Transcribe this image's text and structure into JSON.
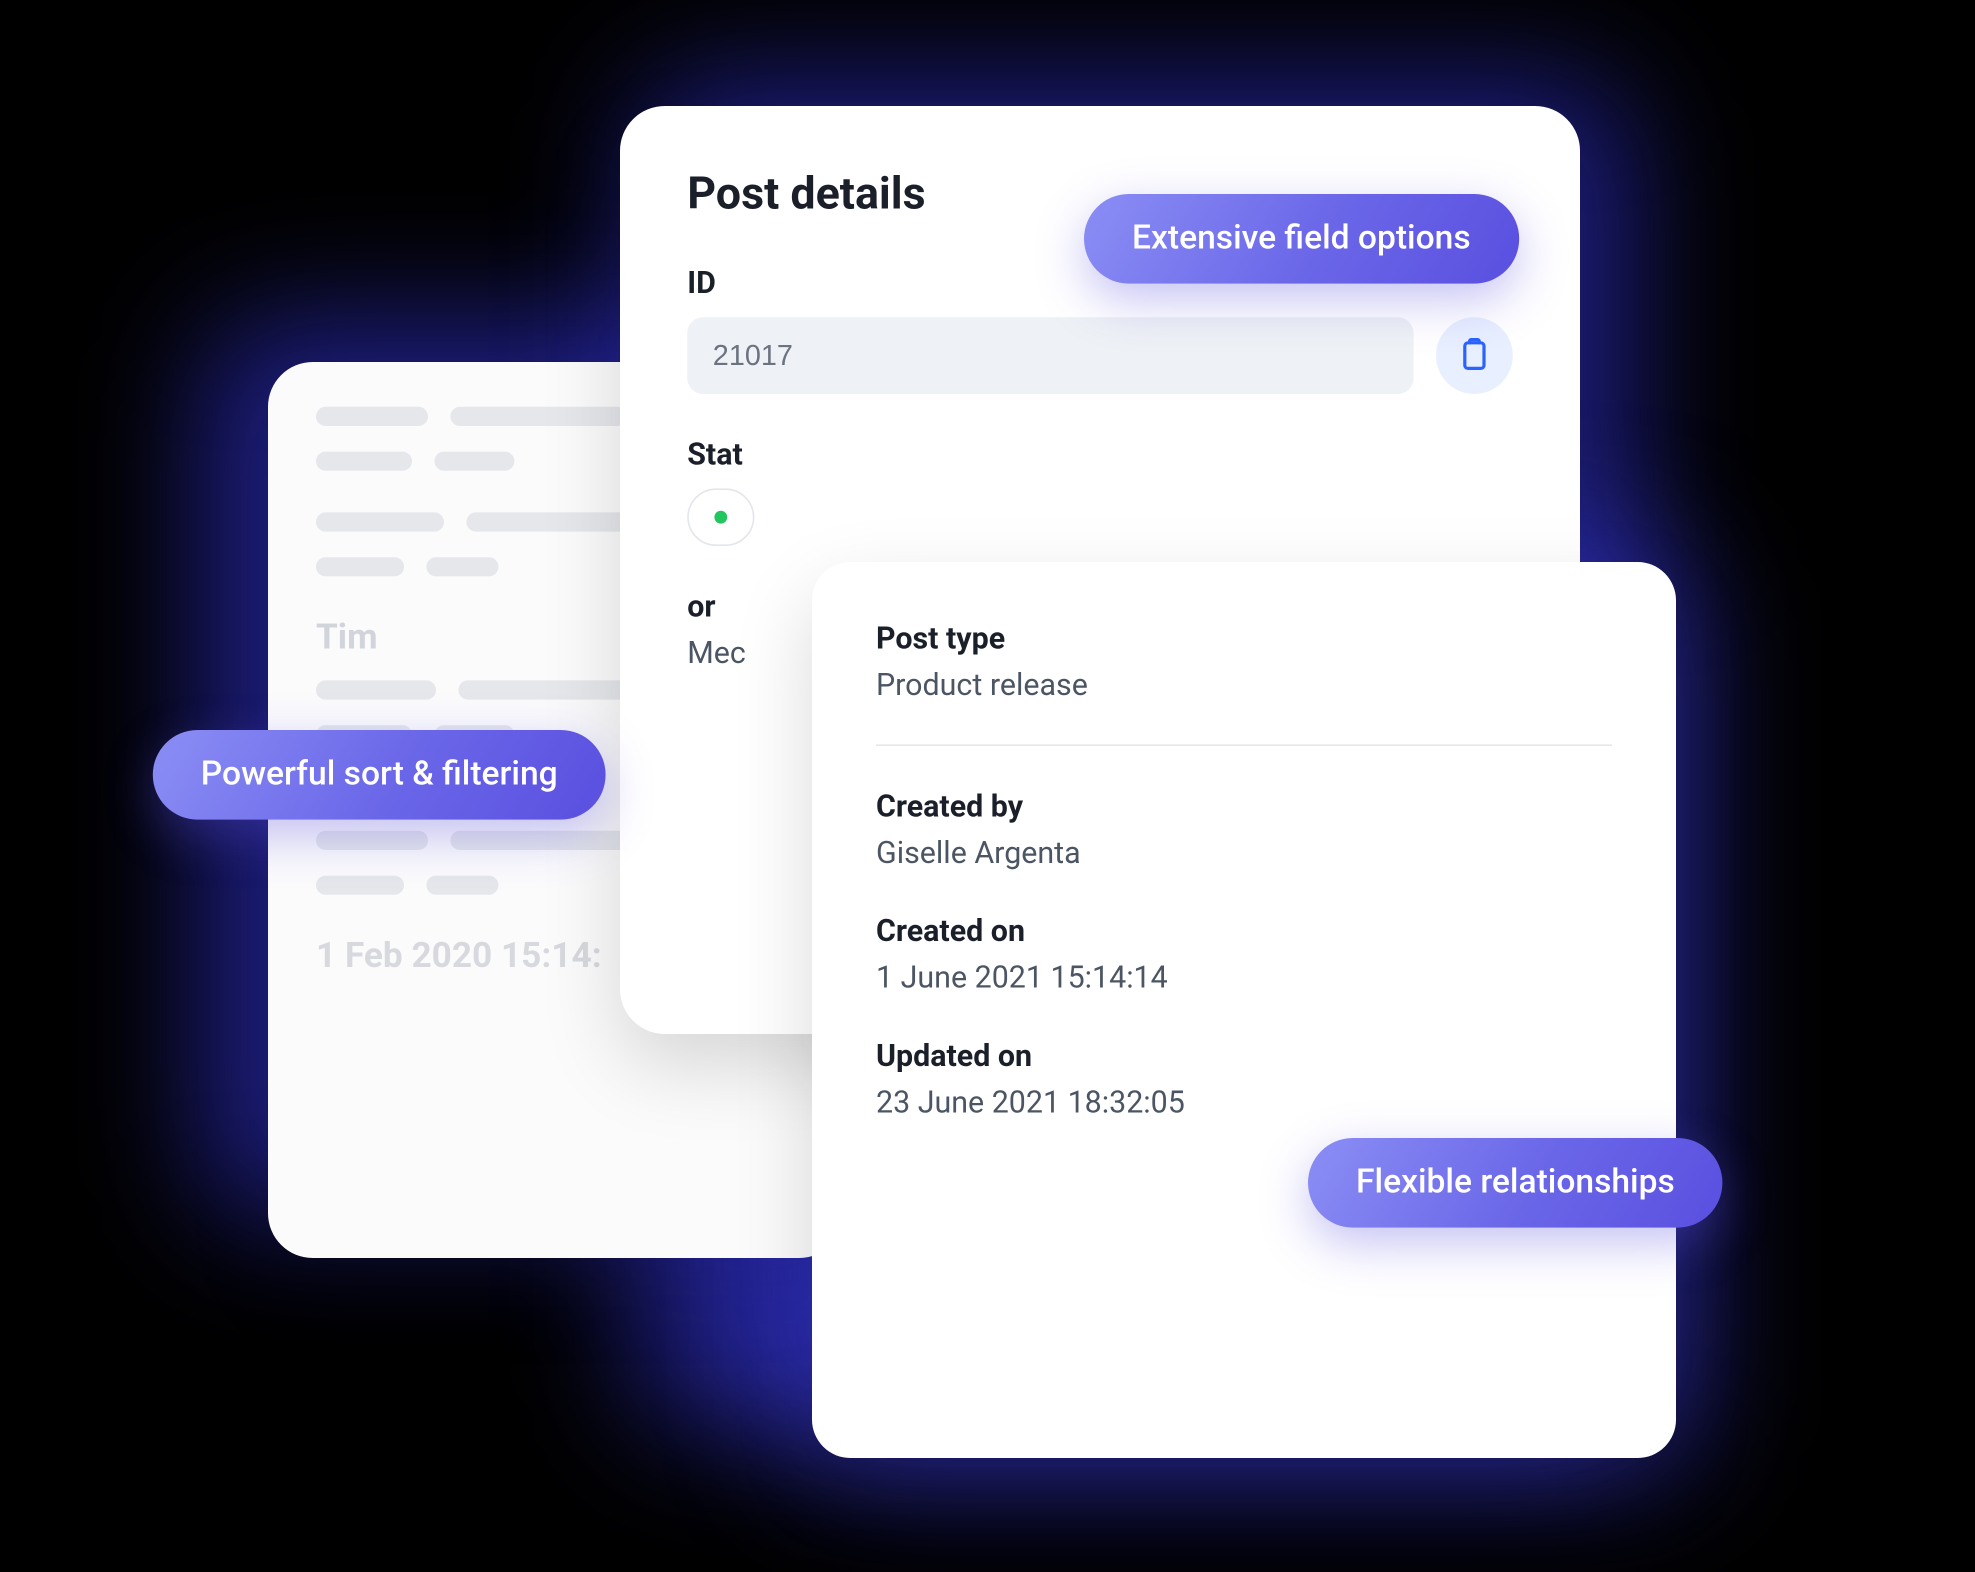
{
  "badges": {
    "sort_filter": "Powerful sort & filtering",
    "field_options": "Extensive field options",
    "relationships": "Flexible relationships"
  },
  "back_card": {
    "name": "Tim",
    "timestamp": "1 Feb 2020 15:14:"
  },
  "details": {
    "title": "Post details",
    "id_label": "ID",
    "id_value": "21017",
    "status_label_partial": "Stat",
    "content_label_partial": "or",
    "content_value_partial": "Mec"
  },
  "meta": {
    "post_type_label": "Post type",
    "post_type_value": "Product release",
    "created_by_label": "Created by",
    "created_by_value": "Giselle Argenta",
    "created_on_label": "Created on",
    "created_on_value": "1 June 2021 15:14:14",
    "updated_on_label": "Updated on",
    "updated_on_value": "23 June 2021 18:32:05"
  }
}
